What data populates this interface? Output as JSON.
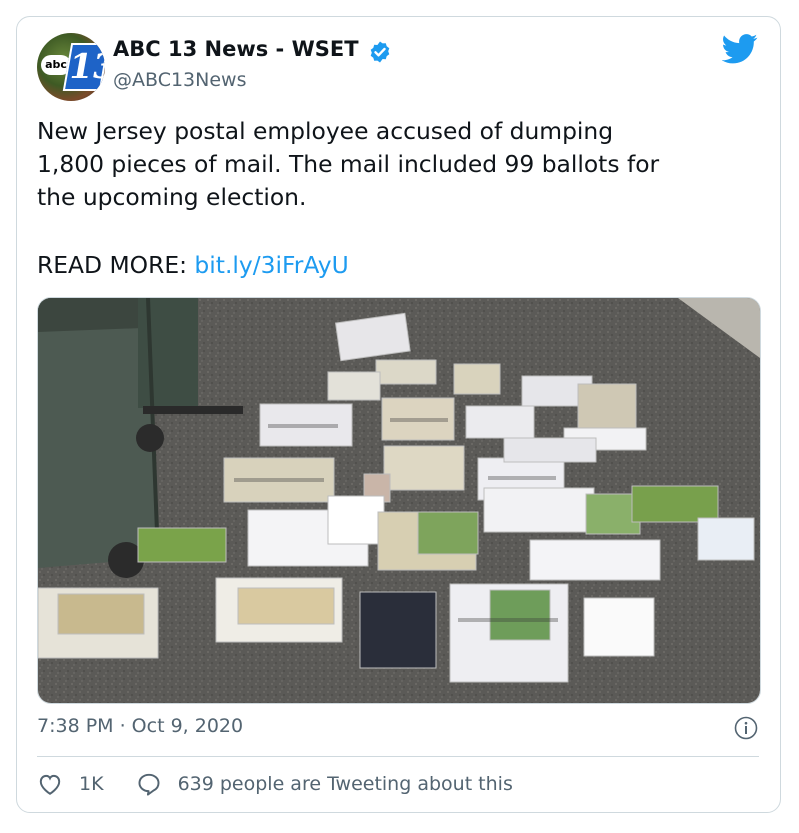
{
  "author": {
    "name": "ABC 13 News - WSET",
    "handle": "@ABC13News",
    "avatar_text_abc": "abc",
    "avatar_text_13": "13",
    "verified": true
  },
  "tweet": {
    "text": "New Jersey postal employee accused of dumping\n1,800 pieces of mail. The mail included 99 ballots for\nthe upcoming election.",
    "read_more_label": "READ MORE:",
    "link": "bit.ly/3iFrAyU",
    "timestamp": "7:38 PM · Oct 9, 2020"
  },
  "actions": {
    "like_count": "1K",
    "tweeting_text": "639 people are Tweeting about this"
  },
  "colors": {
    "accent": "#1d9bf0",
    "verified": "#1d9bf0",
    "secondary_text": "#536471",
    "border": "#cfd9de"
  }
}
